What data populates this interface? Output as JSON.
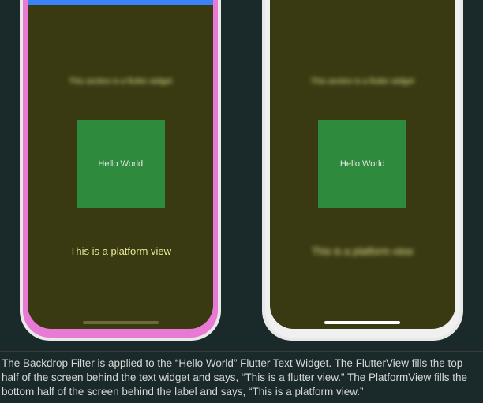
{
  "phones": {
    "left": {
      "top_text": "This section is a flutter widget",
      "box_label": "Hello World",
      "bottom_text": "This is a platform view"
    },
    "right": {
      "top_text": "This section is a flutter widget",
      "box_label": "Hello World",
      "bottom_text": "This is a platform view"
    }
  },
  "caption": "The Backdrop Filter is applied to the “Hello World” Flutter Text Widget. The FlutterView fills the top half of the screen behind the text widget and says, “This is a flutter view.” The PlatformView fills the bottom half of the screen behind the label and says, “This is a platform view.”"
}
